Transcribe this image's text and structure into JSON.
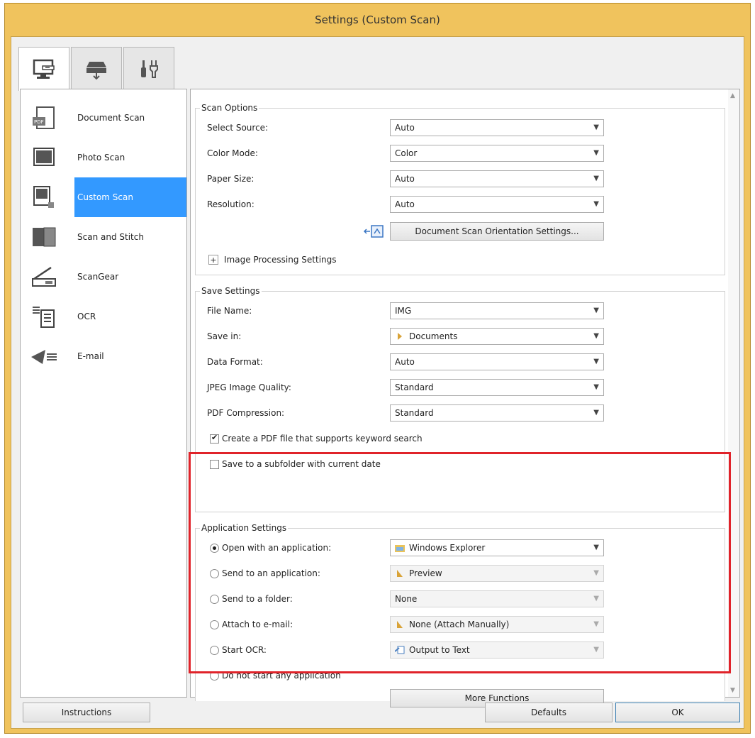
{
  "window": {
    "title": "Settings (Custom Scan)"
  },
  "tabs": [
    {
      "icon": "computer-scan-icon",
      "active": true
    },
    {
      "icon": "scanner-icon",
      "active": false
    },
    {
      "icon": "tools-icon",
      "active": false
    }
  ],
  "left_list": {
    "items": [
      {
        "label": "Document Scan",
        "icon": "document-scan-icon"
      },
      {
        "label": "Photo Scan",
        "icon": "photo-scan-icon"
      },
      {
        "label": "Custom Scan",
        "icon": "custom-scan-icon",
        "selected": true
      },
      {
        "label": "Scan and Stitch",
        "icon": "scan-and-stitch-icon"
      },
      {
        "label": "ScanGear",
        "icon": "scangear-icon"
      },
      {
        "label": "OCR",
        "icon": "ocr-icon"
      },
      {
        "label": "E-mail",
        "icon": "email-icon"
      }
    ]
  },
  "scan_options": {
    "title": "Scan Options",
    "select_source": {
      "label": "Select Source:",
      "value": "Auto"
    },
    "color_mode": {
      "label": "Color Mode:",
      "value": "Color"
    },
    "paper_size": {
      "label": "Paper Size:",
      "value": "Auto"
    },
    "resolution": {
      "label": "Resolution:",
      "value": "Auto"
    },
    "orientation_button": "Document Scan Orientation Settings...",
    "image_processing": "Image Processing Settings"
  },
  "save_settings": {
    "title": "Save Settings",
    "file_name": {
      "label": "File Name:",
      "value": "IMG"
    },
    "save_in": {
      "label": "Save in:",
      "value": "Documents"
    },
    "data_format": {
      "label": "Data Format:",
      "value": "Auto"
    },
    "jpeg_quality": {
      "label": "JPEG Image Quality:",
      "value": "Standard"
    },
    "pdf_compression": {
      "label": "PDF Compression:",
      "value": "Standard"
    },
    "keyword_search": {
      "label": "Create a PDF file that supports keyword search",
      "checked": true
    },
    "subfolder": {
      "label": "Save to a subfolder with current date",
      "checked": false
    }
  },
  "application_settings": {
    "title": "Application Settings",
    "open_with": {
      "label": "Open with an application:",
      "value": "Windows Explorer",
      "selected": true
    },
    "send_to_app": {
      "label": "Send to an application:",
      "value": "Preview"
    },
    "send_to_folder": {
      "label": "Send to a folder:",
      "value": "None"
    },
    "attach_email": {
      "label": "Attach to e-mail:",
      "value": "None (Attach Manually)"
    },
    "start_ocr": {
      "label": "Start OCR:",
      "value": "Output to Text"
    },
    "no_app": {
      "label": "Do not start any application"
    },
    "more_functions": "More Functions"
  },
  "footer": {
    "instructions": "Instructions",
    "defaults": "Defaults",
    "ok": "OK"
  },
  "colors": {
    "selection": "#3399ff",
    "highlight": "#e0232a",
    "frame": "#f0c35d"
  }
}
